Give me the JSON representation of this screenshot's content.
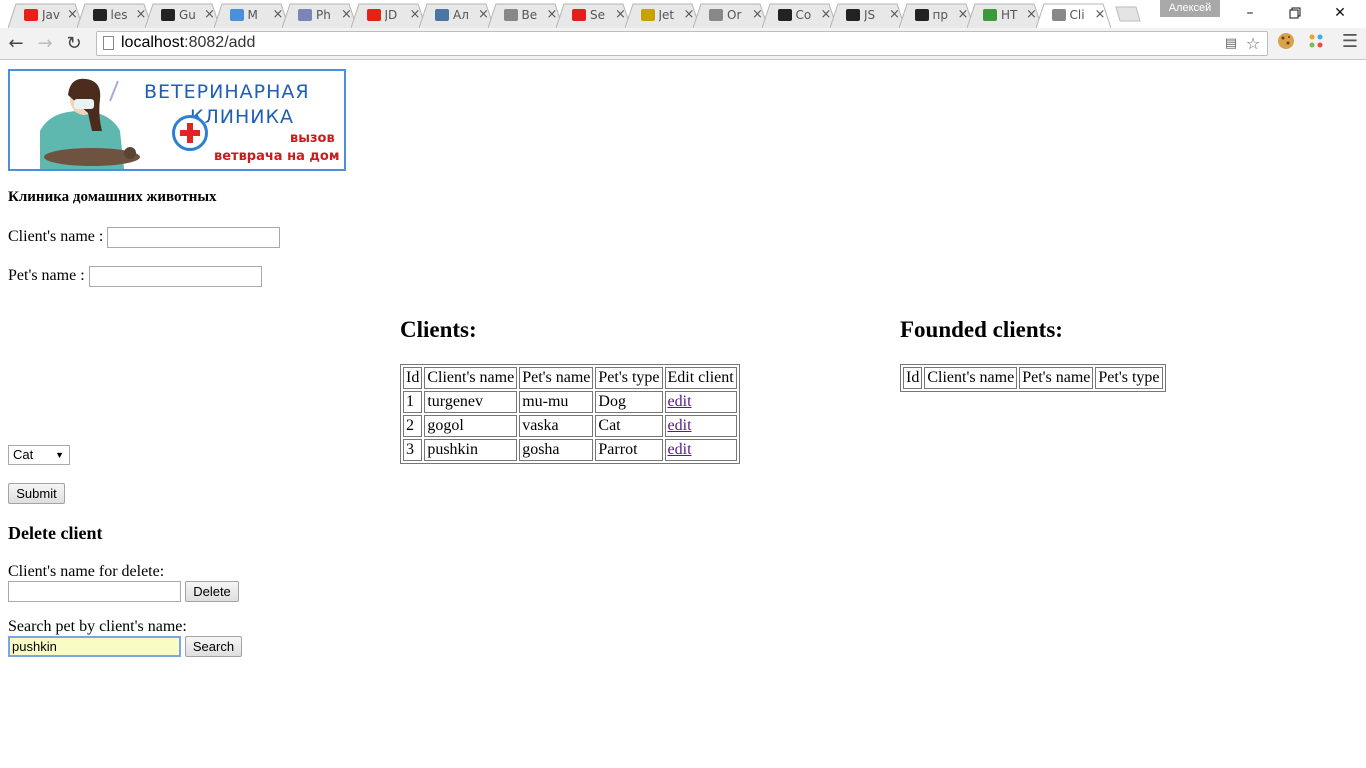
{
  "browser": {
    "tabs": [
      {
        "title": "Jav",
        "icon": "youtube-icon",
        "color": "#e62117"
      },
      {
        "title": "les",
        "icon": "github-icon",
        "color": "#222222"
      },
      {
        "title": "Gu",
        "icon": "github-icon",
        "color": "#222222"
      },
      {
        "title": "M",
        "icon": "m-badge-icon",
        "color": "#4a90d9"
      },
      {
        "title": "Ph",
        "icon": "php-icon",
        "color": "#7a86b8"
      },
      {
        "title": "JD",
        "icon": "youtube-icon",
        "color": "#e62117"
      },
      {
        "title": "Ал",
        "icon": "vk-icon",
        "color": "#4c75a3"
      },
      {
        "title": "Be",
        "icon": "page-icon",
        "color": "#888888"
      },
      {
        "title": "Se",
        "icon": "oracle-icon",
        "color": "#e0201b"
      },
      {
        "title": "Jet",
        "icon": "plug-icon",
        "color": "#c9a100"
      },
      {
        "title": "Or",
        "icon": "page-icon",
        "color": "#888888"
      },
      {
        "title": "Co",
        "icon": "github-icon",
        "color": "#222222"
      },
      {
        "title": "JS",
        "icon": "binary-icon",
        "color": "#222222"
      },
      {
        "title": "пр",
        "icon": "binary-icon",
        "color": "#222222"
      },
      {
        "title": "HT",
        "icon": "check-icon",
        "color": "#3a9a3a"
      },
      {
        "title": "Cli",
        "icon": "page-icon",
        "color": "#888888",
        "active": true
      }
    ],
    "profile_name": "Алексей",
    "url_host": "localhost",
    "url_path": ":8082/add",
    "close_glyph": "×"
  },
  "banner": {
    "line1": "ВЕТЕРИНАРНАЯ",
    "line2": "КЛИНИКА",
    "line3": "вызов",
    "line4": "ветврача на дом"
  },
  "form": {
    "clinic_title": "Клиника домашних животных",
    "client_name_label": "Client's name :",
    "client_name_value": "",
    "pet_name_label": "Pet's name :",
    "pet_name_value": "",
    "pet_type_selected": "Cat",
    "submit_label": "Submit",
    "delete_heading": "Delete client",
    "delete_label": "Client's name for delete:",
    "delete_value": "",
    "delete_button": "Delete",
    "search_label": "Search pet by client's name:",
    "search_value": "pushkin",
    "search_button": "Search"
  },
  "clients": {
    "heading": "Clients:",
    "columns": [
      "Id",
      "Client's name",
      "Pet's name",
      "Pet's type",
      "Edit client"
    ],
    "rows": [
      {
        "id": "1",
        "client": "turgenev",
        "pet": "mu-mu",
        "type": "Dog",
        "edit": "edit"
      },
      {
        "id": "2",
        "client": "gogol",
        "pet": "vaska",
        "type": "Cat",
        "edit": "edit"
      },
      {
        "id": "3",
        "client": "pushkin",
        "pet": "gosha",
        "type": "Parrot",
        "edit": "edit"
      }
    ]
  },
  "found": {
    "heading": "Founded clients:",
    "columns": [
      "Id",
      "Client's name",
      "Pet's name",
      "Pet's type"
    ]
  }
}
